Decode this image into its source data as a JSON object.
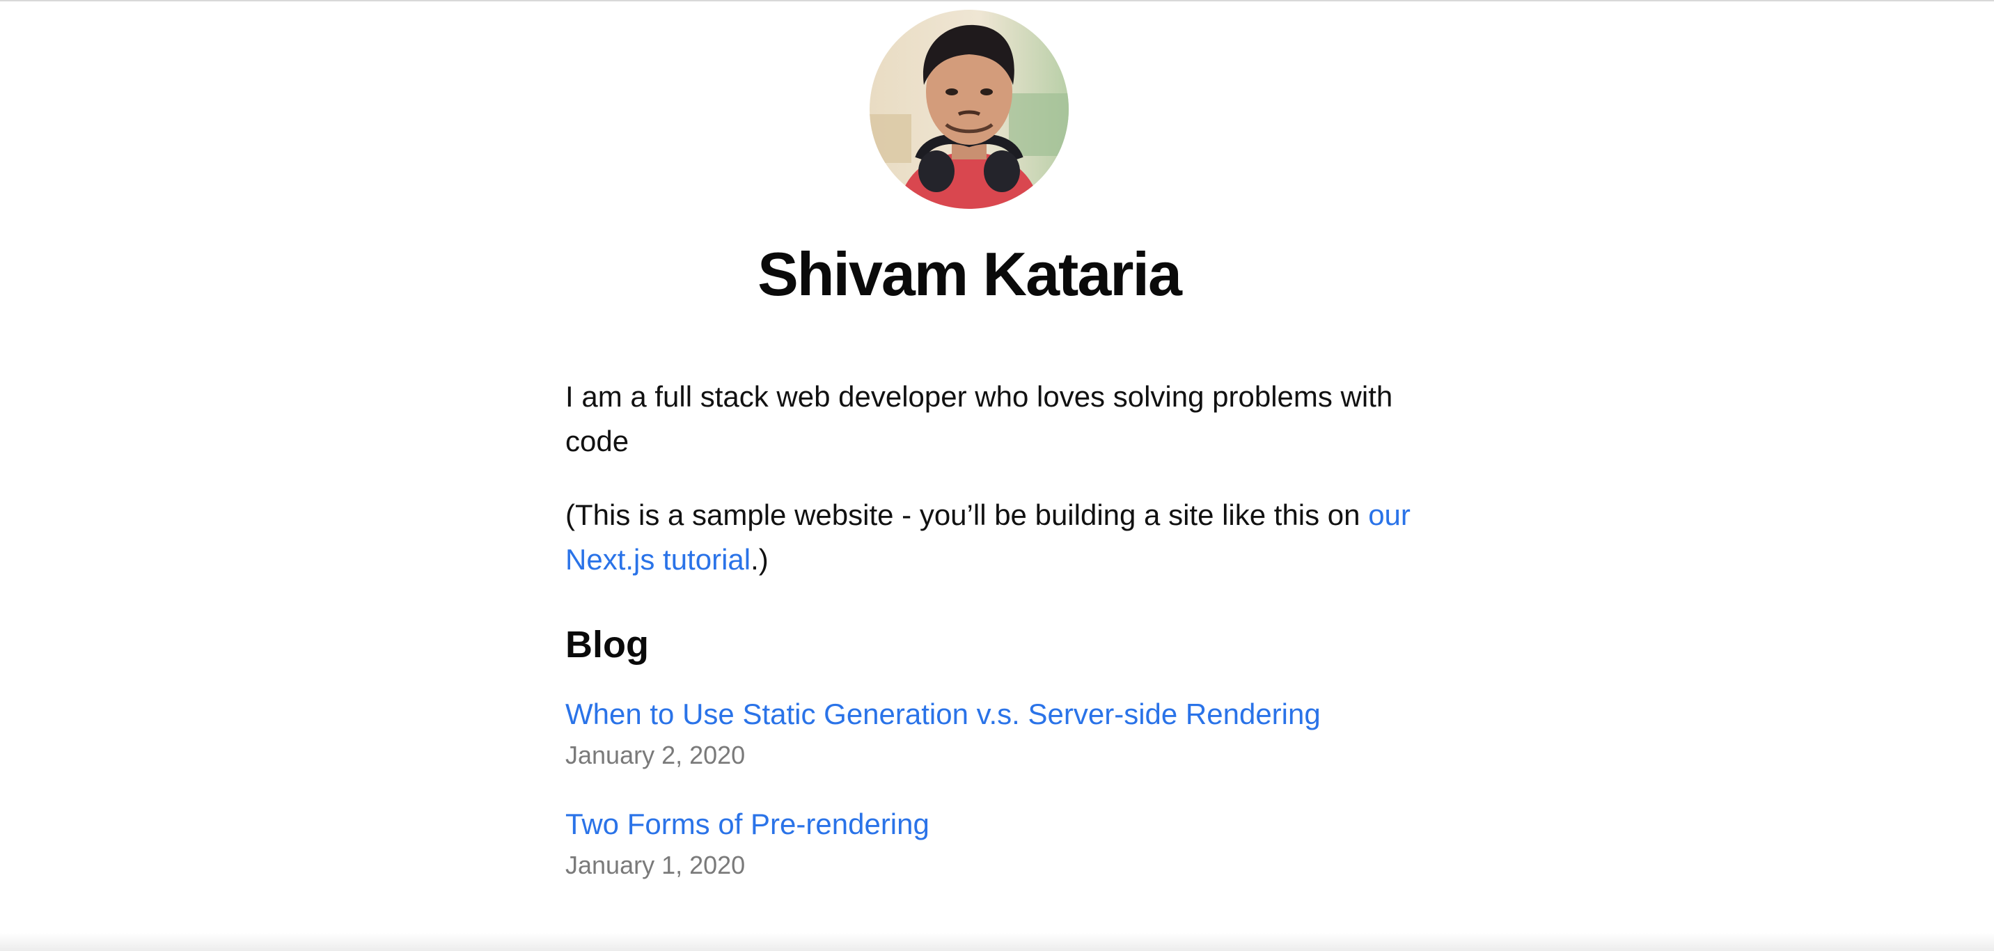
{
  "profile": {
    "name": "Shivam Kataria",
    "avatar_icon": "profile-photo"
  },
  "intro": {
    "bio": "I am a full stack web developer who loves solving problems with code",
    "note_prefix": "(This is a sample website - you’ll be building a site like this on ",
    "note_link": "our Next.js tutorial",
    "note_suffix": ".)"
  },
  "blog": {
    "heading": "Blog",
    "posts": [
      {
        "title": "When to Use Static Generation v.s. Server-side Rendering",
        "date": "January 2, 2020"
      },
      {
        "title": "Two Forms of Pre-rendering",
        "date": "January 1, 2020"
      }
    ]
  },
  "colors": {
    "link": "#2a73e8",
    "date": "#7a7a7a",
    "text": "#111111"
  }
}
